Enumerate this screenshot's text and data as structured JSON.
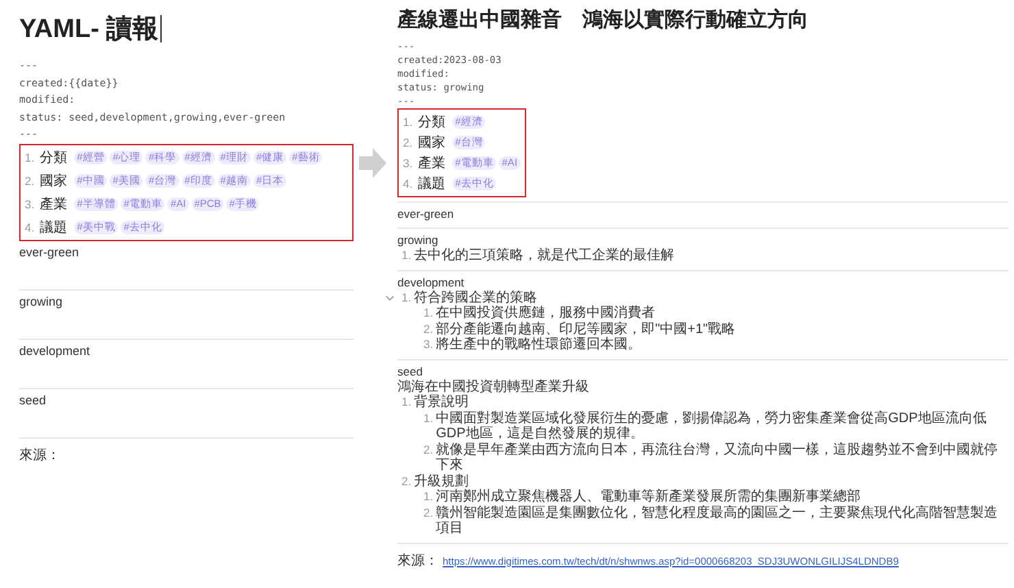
{
  "panels": [
    {
      "kind": "template",
      "title": "YAML- 讀報",
      "cursor": true,
      "frontmatter": [
        "---",
        "created:{{date}}",
        "modified:",
        "status: seed,development,growing,ever-green",
        "---"
      ],
      "tag_box": {
        "highlighted": true,
        "rows": [
          {
            "number": "1.",
            "label": "分類",
            "tags": [
              "#經營",
              "#心理",
              "#科學",
              "#經濟",
              "#理財",
              "#健康",
              "#藝術"
            ]
          },
          {
            "number": "2.",
            "label": "國家",
            "tags": [
              "#中國",
              "#美國",
              "#台灣",
              "#印度",
              "#越南",
              "#日本"
            ]
          },
          {
            "number": "3.",
            "label": "產業",
            "tags": [
              "#半導體",
              "#電動車",
              "#AI",
              "#PCB",
              "#手機"
            ]
          },
          {
            "number": "4.",
            "label": "議題",
            "tags": [
              "#美中戰",
              "#去中化"
            ]
          }
        ]
      },
      "sections": [
        {
          "heading": "ever-green"
        },
        {
          "heading": "growing"
        },
        {
          "heading": "development"
        },
        {
          "heading": "seed"
        }
      ],
      "source": {
        "label": "來源："
      }
    },
    {
      "kind": "note",
      "title": "產線遷出中國雜音　鴻海以實際行動確立方向",
      "cursor": false,
      "frontmatter": [
        "---",
        "created:2023-08-03",
        "modified:",
        "status: growing",
        "---"
      ],
      "tag_box": {
        "highlighted": true,
        "rows": [
          {
            "number": "1.",
            "label": "分類",
            "tags": [
              "#經濟"
            ]
          },
          {
            "number": "2.",
            "label": "國家",
            "tags": [
              "#台灣"
            ]
          },
          {
            "number": "3.",
            "label": "產業",
            "tags": [
              "#電動車",
              "#AI"
            ]
          },
          {
            "number": "4.",
            "label": "議題",
            "tags": [
              "#去中化"
            ]
          }
        ]
      },
      "sections": [
        {
          "heading": "ever-green"
        },
        {
          "heading": "growing",
          "items": [
            {
              "number": "1.",
              "text": "去中化的三項策略，就是代工企業的最佳解"
            }
          ]
        },
        {
          "heading": "development",
          "items": [
            {
              "number": "1.",
              "text": "符合跨國企業的策略",
              "expanded": true,
              "children": [
                {
                  "number": "1.",
                  "text": "在中國投資供應鏈，服務中國消費者"
                },
                {
                  "number": "2.",
                  "text": "部分產能遷向越南、印尼等國家，即\"中國+1\"戰略"
                },
                {
                  "number": "3.",
                  "text": "將生產中的戰略性環節遷回本國。"
                }
              ]
            }
          ]
        },
        {
          "heading": "seed",
          "intro": "鴻海在中國投資朝轉型產業升級",
          "items": [
            {
              "number": "1.",
              "text": "背景說明",
              "children": [
                {
                  "number": "1.",
                  "text": "中國面對製造業區域化發展衍生的憂慮，劉揚偉認為，勞力密集產業會從高GDP地區流向低GDP地區，這是自然發展的規律。"
                },
                {
                  "number": "2.",
                  "text": "就像是早年產業由西方流向日本，再流往台灣，又流向中國一樣，這股趨勢並不會到中國就停下來"
                }
              ]
            },
            {
              "number": "2.",
              "text": "升級規劃",
              "children": [
                {
                  "number": "1.",
                  "text": "河南鄭州成立聚焦機器人、電動車等新產業發展所需的集團新事業總部"
                },
                {
                  "number": "2.",
                  "text": "贛州智能製造園區是集團數位化，智慧化程度最高的園區之一，主要聚焦現代化高階智慧製造項目"
                }
              ]
            }
          ]
        }
      ],
      "source": {
        "label": "來源：",
        "link": "https://www.digitimes.com.tw/tech/dt/n/shwnws.asp?id=0000668203_SDJ3UWONLGILIJS4LDNDB9"
      }
    }
  ]
}
